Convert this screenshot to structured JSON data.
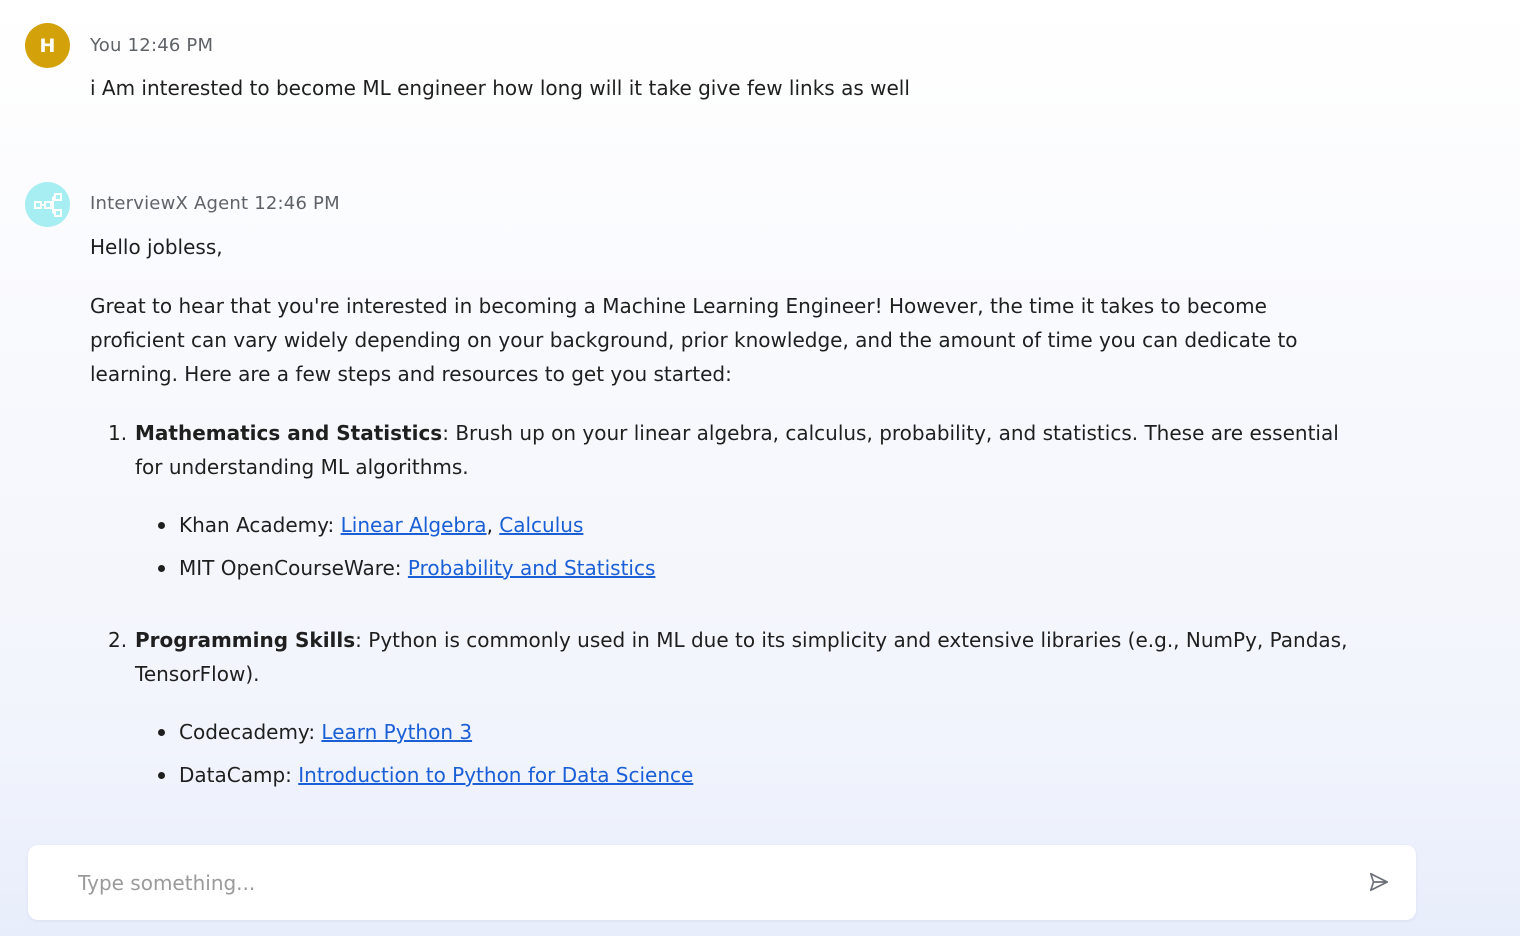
{
  "messages": {
    "user": {
      "avatar_letter": "H",
      "sender": "You",
      "time": "12:46 PM",
      "text": "i Am interested to become ML engineer how long will it take give few links as well"
    },
    "agent": {
      "avatar_icon": "flowchart-icon",
      "sender": "InterviewX Agent",
      "time": "12:46 PM",
      "greeting": "Hello jobless,",
      "intro": "Great to hear that you're interested in becoming a Machine Learning Engineer! However, the time it takes to become proficient can vary widely depending on your background, prior knowledge, and the amount of time you can dedicate to learning. Here are a few steps and resources to get you started:",
      "steps": [
        {
          "number": "1.",
          "title": "Mathematics and Statistics",
          "text": ": Brush up on your linear algebra, calculus, probability, and statistics. These are essential for understanding ML algorithms.",
          "resources": [
            {
              "source": "Khan Academy: ",
              "link1": "Linear Algebra",
              "separator": ", ",
              "link2": "Calculus"
            },
            {
              "source": "MIT OpenCourseWare: ",
              "link1": "Probability and Statistics"
            }
          ]
        },
        {
          "number": "2.",
          "title": "Programming Skills",
          "text": ": Python is commonly used in ML due to its simplicity and extensive libraries (e.g., NumPy, Pandas, TensorFlow).",
          "resources": [
            {
              "source": "Codecademy: ",
              "link1": "Learn Python 3"
            },
            {
              "source": "DataCamp: ",
              "link1": "Introduction to Python for Data Science"
            }
          ]
        }
      ]
    }
  },
  "composer": {
    "placeholder": "Type something...",
    "send_icon": "send-icon"
  },
  "colors": {
    "user_avatar": "#d3a20a",
    "agent_avatar": "#a6eef2",
    "link": "#1a5fd6"
  }
}
